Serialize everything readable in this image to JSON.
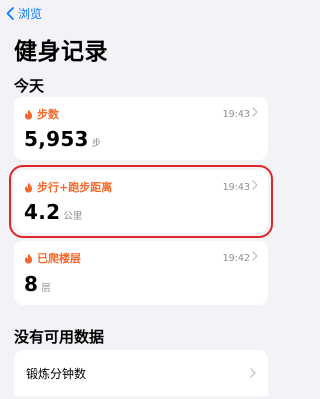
{
  "nav": {
    "back_label": "浏览"
  },
  "page": {
    "title": "健身记录"
  },
  "sections": {
    "today": "今天",
    "no_data": "没有可用数据"
  },
  "cards": [
    {
      "label": "步数",
      "time": "19:43",
      "value": "5,953",
      "unit": "步"
    },
    {
      "label": "步行+跑步距离",
      "time": "19:43",
      "value": "4.2",
      "unit": "公里"
    },
    {
      "label": "已爬楼层",
      "time": "19:42",
      "value": "8",
      "unit": "层"
    }
  ],
  "no_data_items": [
    {
      "label": "锻炼分钟数"
    }
  ],
  "colors": {
    "accent": "#0a7aff",
    "metric": "#f46a2c",
    "highlight": "#e0262b",
    "background": "#f2f2f7"
  },
  "icons": {
    "back": "chevron-left-icon",
    "metric": "flame-icon",
    "disclosure": "chevron-right-icon"
  }
}
